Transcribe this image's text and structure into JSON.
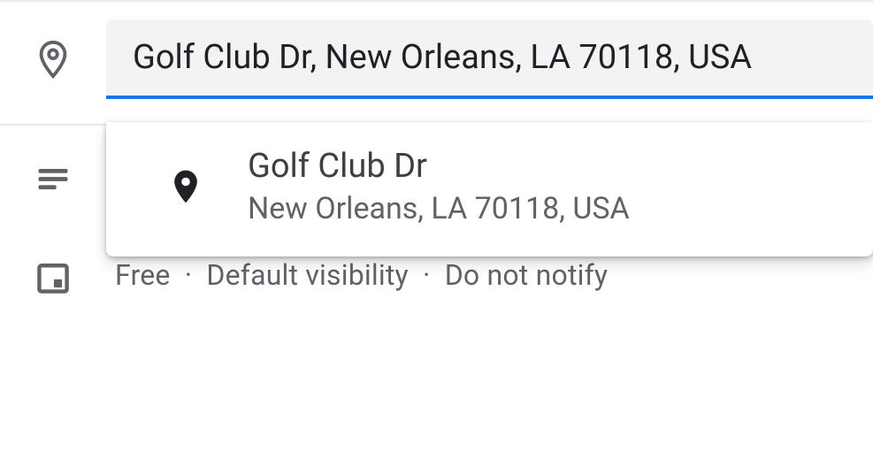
{
  "location": {
    "input_value": "Golf Club Dr, New Orleans, LA 70118, USA"
  },
  "suggestions": [
    {
      "primary": "Golf Club Dr",
      "secondary": "New Orleans, LA 70118, USA"
    }
  ],
  "status": {
    "busy": "Free",
    "visibility": "Default visibility",
    "notify": "Do not notify"
  },
  "colors": {
    "accent": "#1a73e8",
    "icon_gray": "#5f6368",
    "text_primary": "#202124",
    "text_secondary": "#5f6368",
    "input_bg": "#f1f3f4"
  }
}
